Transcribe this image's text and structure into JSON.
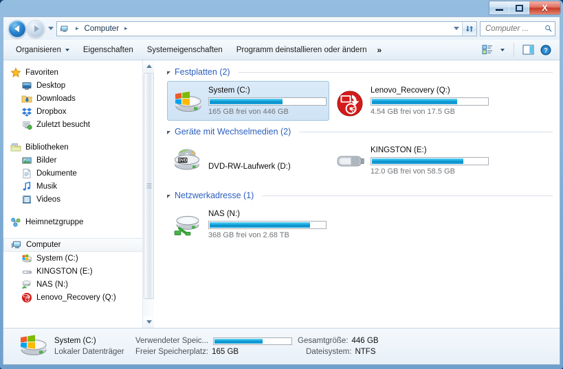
{
  "window": {
    "minimize_label": "Minimieren",
    "maximize_label": "Maximieren",
    "close_label": "X"
  },
  "address": {
    "computer_icon": "computer-icon",
    "crumbs": [
      "Computer"
    ],
    "separator": "▸",
    "dropdown_icon": "chevron-down-icon",
    "refresh_icon": "refresh-icon",
    "back_icon": "back-arrow-icon",
    "forward_icon": "forward-arrow-icon",
    "history_icon": "history-dropdown-icon"
  },
  "search": {
    "placeholder": "Computer ...",
    "value": "",
    "icon": "search-icon"
  },
  "toolbar": {
    "items": [
      {
        "label": "Organisieren",
        "has_caret": true
      },
      {
        "label": "Eigenschaften",
        "has_caret": false
      },
      {
        "label": "Systemeigenschaften",
        "has_caret": false
      },
      {
        "label": "Programm deinstallieren oder ändern",
        "has_caret": false
      },
      {
        "label": "»",
        "has_caret": false
      }
    ],
    "view_icon": "view-layout-icon",
    "view_caret_icon": "chevron-down-icon",
    "preview_icon": "preview-pane-icon",
    "help_icon": "help-icon"
  },
  "sidebar": {
    "items": [
      {
        "label": "Favoriten",
        "icon": "star-icon",
        "level": 0,
        "selected": false
      },
      {
        "label": "Desktop",
        "icon": "desktop-icon",
        "level": 1,
        "selected": false
      },
      {
        "label": "Downloads",
        "icon": "downloads-icon",
        "level": 1,
        "selected": false
      },
      {
        "label": "Dropbox",
        "icon": "dropbox-icon",
        "level": 1,
        "selected": false
      },
      {
        "label": "Zuletzt besucht",
        "icon": "recent-icon",
        "level": 1,
        "selected": false
      },
      {
        "label": "__GAP__",
        "icon": "",
        "level": 0,
        "selected": false
      },
      {
        "label": "Bibliotheken",
        "icon": "libraries-icon",
        "level": 0,
        "selected": false
      },
      {
        "label": "Bilder",
        "icon": "pictures-icon",
        "level": 1,
        "selected": false
      },
      {
        "label": "Dokumente",
        "icon": "documents-icon",
        "level": 1,
        "selected": false
      },
      {
        "label": "Musik",
        "icon": "music-icon",
        "level": 1,
        "selected": false
      },
      {
        "label": "Videos",
        "icon": "videos-icon",
        "level": 1,
        "selected": false
      },
      {
        "label": "__GAP__",
        "icon": "",
        "level": 0,
        "selected": false
      },
      {
        "label": "Heimnetzgruppe",
        "icon": "homegroup-icon",
        "level": 0,
        "selected": false
      },
      {
        "label": "__GAP__",
        "icon": "",
        "level": 0,
        "selected": false
      },
      {
        "label": "Computer",
        "icon": "computer-icon",
        "level": 0,
        "selected": true
      },
      {
        "label": "System (C:)",
        "icon": "windows-drive-icon",
        "level": 1,
        "selected": false
      },
      {
        "label": "KINGSTON (E:)",
        "icon": "usb-drive-icon",
        "level": 1,
        "selected": false
      },
      {
        "label": "NAS (N:)",
        "icon": "network-drive-icon",
        "level": 1,
        "selected": false
      },
      {
        "label": "Lenovo_Recovery (Q:)",
        "icon": "recovery-drive-icon",
        "level": 1,
        "selected": false
      }
    ],
    "scroll": {
      "up_icon": "scroll-up-icon",
      "down_icon": "scroll-down-icon"
    }
  },
  "content": {
    "groups": [
      {
        "title": "Festplatten (2)",
        "collapse_icon": "triangle-collapse-icon",
        "drives": [
          {
            "name": "System (C:)",
            "sub": "165 GB frei von 446 GB",
            "icon": "windows-drive-icon",
            "has_bar": true,
            "fill_percent": 63,
            "selected": true
          },
          {
            "name": "Lenovo_Recovery (Q:)",
            "sub": "4.54 GB frei von 17.5 GB",
            "icon": "recovery-drive-icon",
            "has_bar": true,
            "fill_percent": 74,
            "selected": false
          }
        ]
      },
      {
        "title": "Geräte mit Wechselmedien (2)",
        "collapse_icon": "triangle-collapse-icon",
        "drives": [
          {
            "name": "DVD-RW-Laufwerk (D:)",
            "sub": "",
            "icon": "dvd-drive-icon",
            "has_bar": false,
            "fill_percent": 0,
            "selected": false
          },
          {
            "name": "KINGSTON (E:)",
            "sub": "12.0 GB frei von 58.5 GB",
            "icon": "usb-drive-icon",
            "has_bar": true,
            "fill_percent": 79,
            "selected": false
          }
        ]
      },
      {
        "title": "Netzwerkadresse (1)",
        "collapse_icon": "triangle-collapse-icon",
        "drives": [
          {
            "name": "NAS (N:)",
            "sub": "368 GB frei von 2.68 TB",
            "icon": "network-drive-icon",
            "has_bar": true,
            "fill_percent": 87,
            "selected": false
          }
        ]
      }
    ]
  },
  "details": {
    "icon": "windows-drive-icon",
    "name": "System (C:)",
    "type": "Lokaler Datenträger",
    "used_label": "Verwendeter Speic...",
    "used_fill_percent": 63,
    "free_label": "Freier Speicherplatz:",
    "free_value": "165 GB",
    "total_label": "Gesamtgröße:",
    "total_value": "446 GB",
    "fs_label": "Dateisystem:",
    "fs_value": "NTFS"
  },
  "colors": {
    "accent_blue": "#2b5fbf",
    "bar_fill": "#16a8e0",
    "selection": "#cfe3f5",
    "close_red": "#c63c27"
  }
}
